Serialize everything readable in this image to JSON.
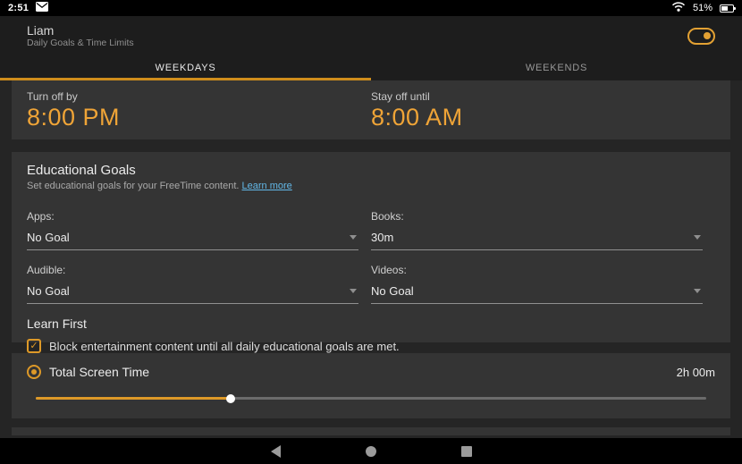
{
  "colors": {
    "accent_orange": "#e3a133",
    "tab_underline_orange": "#cf8d1c",
    "link_blue": "#62b8e8",
    "card_background": "#343434",
    "page_background": "#252525",
    "bar_background": "#1d1d1d"
  },
  "icons": {
    "check": "✓"
  },
  "status_bar": {
    "time": "2:51",
    "battery_percent": "51%"
  },
  "header": {
    "name": "Liam",
    "subtitle": "Daily Goals & Time Limits",
    "toggle_on": true
  },
  "tabs": [
    {
      "label": "WEEKDAYS",
      "active": true
    },
    {
      "label": "WEEKENDS",
      "active": false
    }
  ],
  "curfew": {
    "turn_off": {
      "label": "Turn off by",
      "time": "8:00 PM"
    },
    "stay_off": {
      "label": "Stay off until",
      "time": "8:00 AM"
    }
  },
  "educational_goals": {
    "title": "Educational Goals",
    "subtitle": "Set educational goals for your FreeTime content.",
    "link_label": "Learn more",
    "fields": [
      {
        "label": "Apps:",
        "value": "No Goal"
      },
      {
        "label": "Books:",
        "value": "30m"
      },
      {
        "label": "Audible:",
        "value": "No Goal"
      },
      {
        "label": "Videos:",
        "value": "No Goal"
      }
    ],
    "learn_first": {
      "title": "Learn First",
      "checkbox_label": "Block entertainment content until all daily educational goals are met.",
      "checked": true
    }
  },
  "screen_time": {
    "label": "Total Screen Time",
    "value": "2h 00m",
    "slider_percent": 29
  }
}
